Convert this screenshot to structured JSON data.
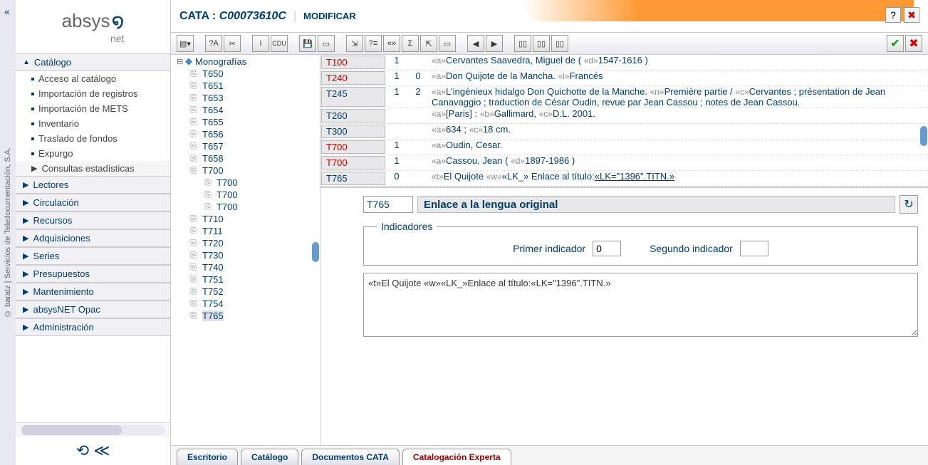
{
  "left_edge_text": "© baratz | Servicios de Teledocumentación, S.A.",
  "logo": {
    "main": "absys",
    "sub": "net"
  },
  "nav": {
    "catalogo": {
      "label": "Catálogo",
      "items": [
        "Acceso al catálogo",
        "Importación de registros",
        "Importación de METS",
        "Inventario",
        "Traslado de fondos",
        "Expurgo",
        "Consultas estadísticas"
      ]
    },
    "others": [
      "Lectores",
      "Circulación",
      "Recursos",
      "Adquisiciones",
      "Series",
      "Presupuestos",
      "Mantenimiento",
      "absysNET Opac",
      "Administración"
    ]
  },
  "top": {
    "module": "CATA",
    "id": "C00073610C",
    "action": "MODIFICAR"
  },
  "tree": {
    "root": "Monografías",
    "items": [
      "T650",
      "T651",
      "T653",
      "T654",
      "T655",
      "T656",
      "T657",
      "T658",
      "T700"
    ],
    "sub700": [
      "T700",
      "T700",
      "T700"
    ],
    "items2": [
      "T710",
      "T711",
      "T720",
      "T730",
      "T740",
      "T751",
      "T752",
      "T754",
      "T765"
    ],
    "selected": "T765"
  },
  "fields": [
    {
      "tag": "T100",
      "red": true,
      "i1": "1",
      "i2": "",
      "content": [
        [
          "a",
          "Cervantes Saavedra, Miguel de"
        ],
        [
          "plain",
          " ( "
        ],
        [
          "d",
          "1547-1616"
        ],
        [
          "plain",
          ")"
        ]
      ]
    },
    {
      "tag": "T240",
      "red": true,
      "i1": "1",
      "i2": "0",
      "content": [
        [
          "a",
          "Don Quijote de la Mancha."
        ],
        [
          "l",
          "Francés"
        ]
      ]
    },
    {
      "tag": "T245",
      "red": false,
      "i1": "1",
      "i2": "2",
      "content": [
        [
          "a",
          "L'ingénieux hidalgo Don Quichotte de la Manche."
        ],
        [
          "n",
          "Première partie"
        ],
        [
          "plain",
          " / "
        ],
        [
          "c",
          "Cervantes ; présentation de Jean Canavaggio ; traduction de César Oudin, revue par Jean Cassou ; notes de Jean Cassou."
        ]
      ]
    },
    {
      "tag": "T260",
      "red": false,
      "i1": "",
      "i2": "",
      "content": [
        [
          "a",
          "[Paris] :"
        ],
        [
          "b",
          "Gallimard,"
        ],
        [
          "c",
          "D.L. 2001."
        ]
      ]
    },
    {
      "tag": "T300",
      "red": false,
      "i1": "",
      "i2": "",
      "content": [
        [
          "a",
          "634 ;"
        ],
        [
          "c",
          "18 cm."
        ]
      ]
    },
    {
      "tag": "T700",
      "red": true,
      "i1": "1",
      "i2": "",
      "content": [
        [
          "a",
          "Oudin, Cesar."
        ]
      ]
    },
    {
      "tag": "T700",
      "red": true,
      "i1": "1",
      "i2": "",
      "content": [
        [
          "a",
          "Cassou, Jean"
        ],
        [
          "plain",
          " ( "
        ],
        [
          "d",
          "1897-1986"
        ],
        [
          "plain",
          ")"
        ]
      ]
    },
    {
      "tag": "T765",
      "red": false,
      "i1": "0",
      "i2": "",
      "content": [
        [
          "t",
          "El Quijote"
        ],
        [
          "w",
          "«LK_»"
        ],
        [
          "plain",
          "Enlace al título:"
        ],
        [
          "link",
          "«LK=\"1396\".TITN.»"
        ]
      ]
    }
  ],
  "editor": {
    "tag": "T765",
    "label": "Enlace a la lengua original",
    "indicators_legend": "Indicadores",
    "ind1_label": "Primer indicador",
    "ind1_value": "0",
    "ind2_label": "Segundo indicador",
    "ind2_value": "",
    "content": "«t»El Quijote «w»«LK_»Enlace al título:«LK=\"1396\".TITN.»"
  },
  "tabs": [
    "Escritorio",
    "Catálogo",
    "Documentos CATA",
    "Catalogación Experta"
  ],
  "active_tab": 3
}
